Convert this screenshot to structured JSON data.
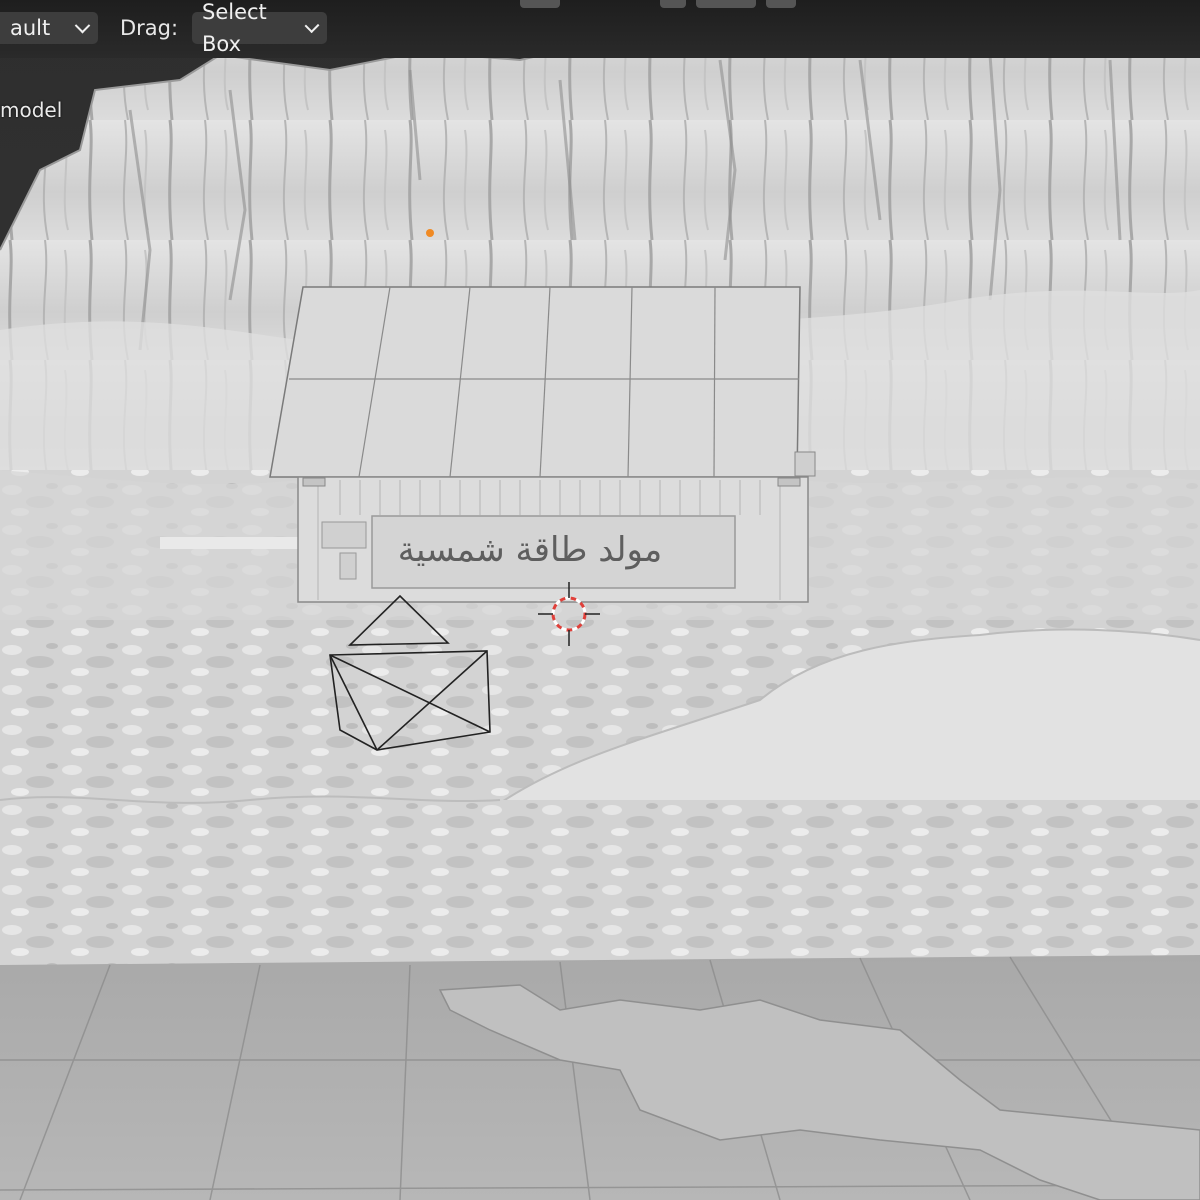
{
  "header": {
    "mode_dropdown": {
      "value": "ault"
    },
    "drag": {
      "label": "Drag:",
      "value": "Select Box"
    }
  },
  "outliner_overlay": {
    "label": "model"
  },
  "scene": {
    "signboard_text": "مولد طاقة شمسية"
  },
  "icons": {
    "chevron": "chevron-down-icon",
    "cursor": "3d-cursor-icon",
    "camera": "camera-object-icon",
    "origin": "object-origin-icon"
  },
  "colors": {
    "header_bg": "#3d3d3d",
    "header_text": "#f0f0f0",
    "origin_dot": "#f08a24",
    "cursor_red": "#e0403a",
    "mesh": "#d9d9d9"
  }
}
